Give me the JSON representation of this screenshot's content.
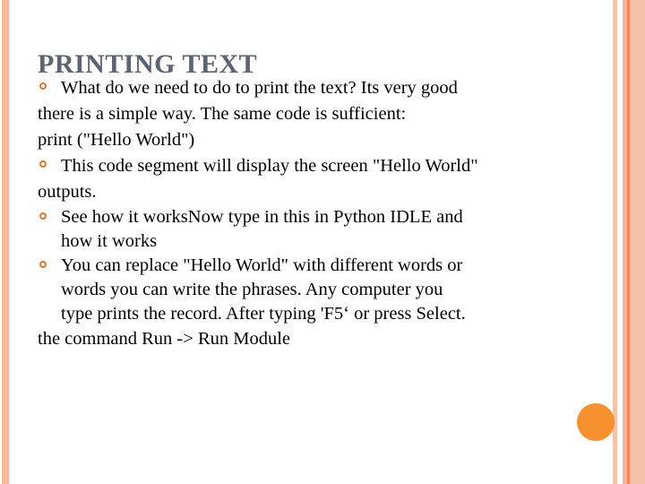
{
  "slide": {
    "title": "PRINTING TEXT",
    "theme": {
      "title_color": "#5d6371",
      "bullet_color": "#e8762a",
      "accent_circle_color": "#f7912e",
      "border_salmon": "#f8b89c",
      "border_orange_line": "#f2865a",
      "background": "#ffffff"
    },
    "blocks": [
      {
        "bullet": "What do we need to do to print the text? Its very good",
        "continuations": [
          {
            "text": "there is a simple way. The same code is sufficient:",
            "indent": false
          },
          {
            "text": "print (\"Hello World\")",
            "indent": false
          }
        ]
      },
      {
        "bullet": "This code segment will display the screen \"Hello World\"",
        "continuations": [
          {
            "text": "outputs.",
            "indent": false
          }
        ]
      },
      {
        "bullet": "See how it worksNow type in this in Python IDLE and",
        "continuations": [
          {
            "text": "how it works",
            "indent": true
          }
        ]
      },
      {
        "bullet": "You can replace \"Hello World\" with different words or",
        "continuations": [
          {
            "text": "words  you can write the phrases. Any computer you",
            "indent": true
          },
          {
            "text": "type prints the record. After typing 'F5‘ or press Select.",
            "indent": true
          },
          {
            "text": "the command  Run -> Run Module",
            "indent": false
          }
        ]
      }
    ]
  }
}
